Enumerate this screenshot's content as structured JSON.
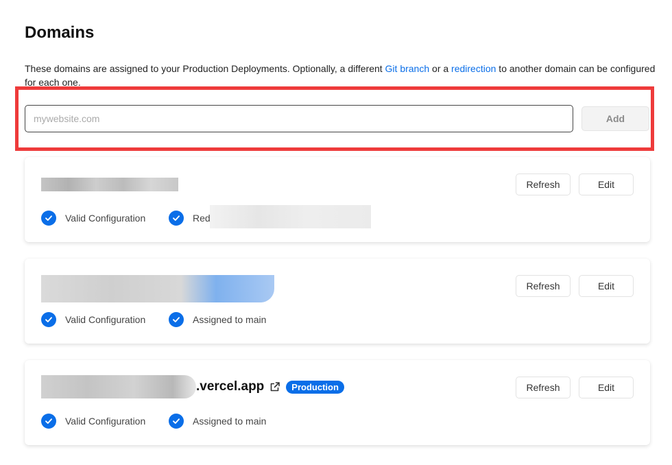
{
  "page": {
    "title": "Domains",
    "description_before": "These domains are assigned to your Production Deployments. Optionally, a different ",
    "link_git_branch": "Git branch",
    "description_middle": " or a ",
    "link_redirection": "redirection",
    "description_after": " to another domain can be configured for each one."
  },
  "add_domain": {
    "placeholder": "mywebsite.com",
    "button_label": "Add"
  },
  "domains": [
    {
      "buttons": {
        "refresh": "Refresh",
        "edit": "Edit"
      },
      "status_1": "Valid Configuration",
      "status_2": "Red"
    },
    {
      "buttons": {
        "refresh": "Refresh",
        "edit": "Edit"
      },
      "status_1": "Valid Configuration",
      "status_2": "Assigned to main"
    },
    {
      "name_suffix": ".vercel.app",
      "badge": "Production",
      "buttons": {
        "refresh": "Refresh",
        "edit": "Edit"
      },
      "status_1": "Valid Configuration",
      "status_2": "Assigned to main"
    }
  ],
  "colors": {
    "accent": "#0a6ee8",
    "highlight_border": "#ee3b3b"
  },
  "icons": {
    "check": "check-circle-icon",
    "external": "external-link-icon"
  }
}
